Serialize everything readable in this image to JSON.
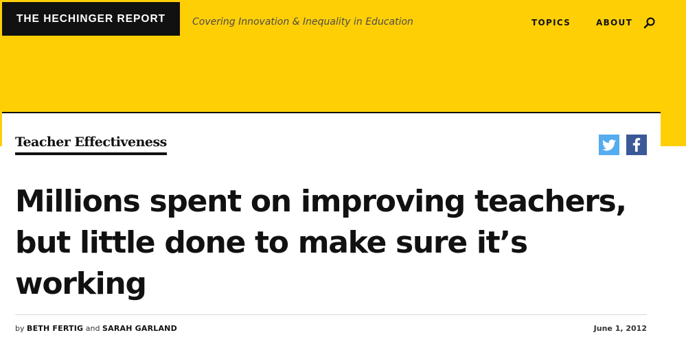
{
  "header": {
    "logo_text": "THE HECHINGER REPORT",
    "tagline": "Covering Innovation & Inequality in Education",
    "nav": {
      "topics": "TOPICS",
      "about": "ABOUT"
    },
    "search_icon": "search-icon",
    "brand_color": "#FFCF06"
  },
  "article": {
    "category": "Teacher Effectiveness",
    "headline": "Millions spent on improving teachers, but little done to make sure it’s working",
    "byline": {
      "by": "by",
      "author1": "BETH FERTIG",
      "and": "and",
      "author2": "SARAH GARLAND"
    },
    "date": "June 1, 2012",
    "share": {
      "twitter_icon": "twitter-icon",
      "facebook_icon": "facebook-icon",
      "twitter_color": "#55ACEE",
      "facebook_color": "#3B5998"
    }
  }
}
